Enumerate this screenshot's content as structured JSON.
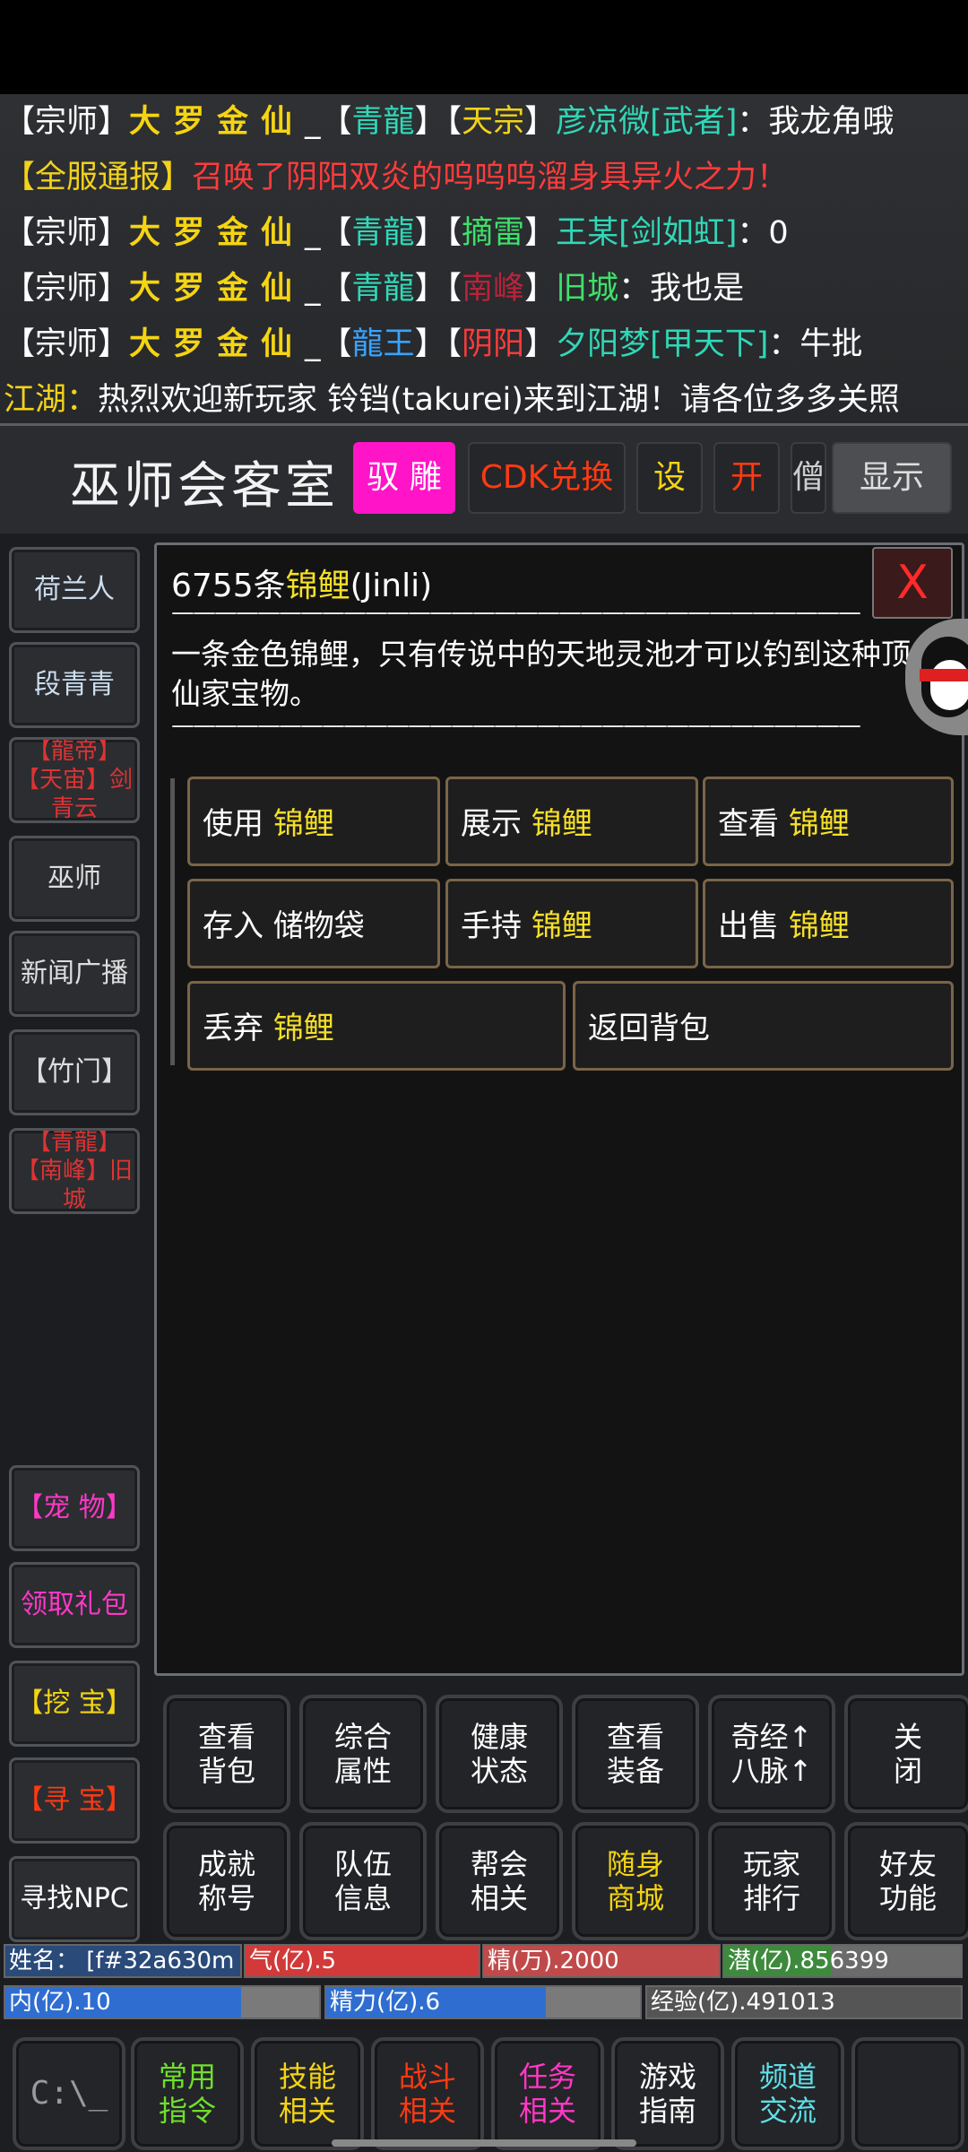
{
  "chat": [
    [
      {
        "t": "【宗师】",
        "c": "c-white"
      },
      {
        "t": "大罗金仙",
        "c": "gold-name"
      },
      {
        "t": "_【",
        "c": "c-white"
      },
      {
        "t": "青龍",
        "c": "c-teal"
      },
      {
        "t": "】【",
        "c": "c-white"
      },
      {
        "t": "天宗",
        "c": "c-yellow"
      },
      {
        "t": "】",
        "c": "c-white"
      },
      {
        "t": "彦凉微[武者]",
        "c": "c-teal"
      },
      {
        "t": "：我龙角哦",
        "c": "c-white"
      }
    ],
    [
      {
        "t": "【全服通报】",
        "c": "c-yellow"
      },
      {
        "t": "召唤了阴阳双炎的呜呜呜溜身具异火之力！",
        "c": "c-red"
      }
    ],
    [
      {
        "t": "【宗师】",
        "c": "c-white"
      },
      {
        "t": "大罗金仙",
        "c": "gold-name"
      },
      {
        "t": "_【",
        "c": "c-white"
      },
      {
        "t": "青龍",
        "c": "c-teal"
      },
      {
        "t": "】【",
        "c": "c-white"
      },
      {
        "t": "摘雷",
        "c": "c-green"
      },
      {
        "t": "】",
        "c": "c-white"
      },
      {
        "t": "王某[剑如虹]",
        "c": "c-teal"
      },
      {
        "t": "：0",
        "c": "c-white"
      }
    ],
    [
      {
        "t": "【宗师】",
        "c": "c-white"
      },
      {
        "t": "大罗金仙",
        "c": "gold-name"
      },
      {
        "t": "_【",
        "c": "c-white"
      },
      {
        "t": "青龍",
        "c": "c-teal"
      },
      {
        "t": "】【",
        "c": "c-white"
      },
      {
        "t": "南峰",
        "c": "c-darkred"
      },
      {
        "t": "】",
        "c": "c-white"
      },
      {
        "t": "旧城",
        "c": "c-green"
      },
      {
        "t": "：我也是",
        "c": "c-white"
      }
    ],
    [
      {
        "t": "【宗师】",
        "c": "c-white"
      },
      {
        "t": "大罗金仙",
        "c": "gold-name"
      },
      {
        "t": "_【",
        "c": "c-white"
      },
      {
        "t": "龍王",
        "c": "c-blue"
      },
      {
        "t": "】【",
        "c": "c-white"
      },
      {
        "t": "阴阳",
        "c": "c-red"
      },
      {
        "t": "】",
        "c": "c-white"
      },
      {
        "t": "夕阳梦[甲天下]",
        "c": "c-teal"
      },
      {
        "t": "：牛批",
        "c": "c-white"
      }
    ],
    [
      {
        "t": "江湖：",
        "c": "c-yellow"
      },
      {
        "t": "热烈欢迎新玩家 铃铛(takurei)来到江湖！请各位多多关照",
        "c": "c-white"
      }
    ]
  ],
  "room": {
    "title": "巫师会客室",
    "buttons": [
      {
        "label": "驭 雕",
        "color": "#ffffff",
        "bg": "#ff14c8"
      },
      {
        "label": "CDK兑换",
        "color": "#ff3a12",
        "bg": "#26282b"
      },
      {
        "label": "设",
        "color": "#f5d413",
        "bg": "#26282b"
      },
      {
        "label": "开",
        "color": "#ff3a12",
        "bg": "#26282b"
      },
      {
        "label": "僧",
        "color": "#cccccc",
        "bg": "#26282b"
      },
      {
        "label": "显示",
        "color": "#dddddd",
        "bg": "#4c4e52"
      }
    ]
  },
  "sidebar": [
    {
      "label": "荷兰人"
    },
    {
      "label": "段青青"
    },
    {
      "label": "【龍帝】【天宙】剑青云"
    },
    {
      "label": "巫师"
    },
    {
      "label": "新闻广播"
    },
    {
      "label": "【竹门】"
    },
    {
      "label": "【青龍】【南峰】旧城"
    },
    {
      "label": "【宠 物】"
    },
    {
      "label": "领取礼包"
    },
    {
      "label": "【挖 宝】"
    },
    {
      "label": "【寻 宝】"
    },
    {
      "label": "寻找NPC"
    }
  ],
  "item": {
    "count_prefix": "6755条",
    "name": "锦鲤",
    "pinyin": "(Jinli)",
    "close": "X",
    "dashes": "————————————————————————————————",
    "description": "一条金色锦鲤，只有传说中的天地灵池才可以钓到这种顶尖仙家宝物。"
  },
  "actions": {
    "use": "使用",
    "show": "展示",
    "view": "查看",
    "store": "存入 储物袋",
    "hold": "手持",
    "sell": "出售",
    "drop": "丢弃",
    "back": "返回背包"
  },
  "commands_row1": [
    "查看\n背包",
    "综合\n属性",
    "健康\n状态",
    "查看\n装备",
    "奇经↑\n八脉↑",
    "关\n闭"
  ],
  "commands_row2": [
    "成就\n称号",
    "队伍\n信息",
    "帮会\n相关",
    "随身\n商城",
    "玩家\n排行",
    "好友\n功能"
  ],
  "stats": {
    "name": "姓名：     [f#32a630m",
    "qi": "气(亿).5",
    "jing": "精(万).2000",
    "qian": "潜(亿).856399",
    "nei": "内(亿).10",
    "jingli": "精力(亿).6",
    "exp": "经验(亿).491013"
  },
  "stat_fill": {
    "qi": 1.0,
    "jing": 1.0,
    "qian": 0.45,
    "nei": 0.75,
    "jingli": 0.7,
    "exp": 1.0
  },
  "dock": [
    {
      "label": "C:\\_",
      "color": "#9a9a9a"
    },
    {
      "label": "常用\n指令",
      "color": "#6ee02c"
    },
    {
      "label": "技能\n相关",
      "color": "#f5d413"
    },
    {
      "label": "战斗\n相关",
      "color": "#ff3a12"
    },
    {
      "label": "任务\n相关",
      "color": "#ff38c7"
    },
    {
      "label": "游戏\n指南",
      "color": "#ffffff"
    },
    {
      "label": "频道\n交流",
      "color": "#5fe0e8"
    },
    {
      "label": "",
      "color": "#9a9a9a"
    }
  ],
  "colors": {
    "item_yellow": "#f6df2a",
    "accent_magenta": "#ff14c8"
  }
}
